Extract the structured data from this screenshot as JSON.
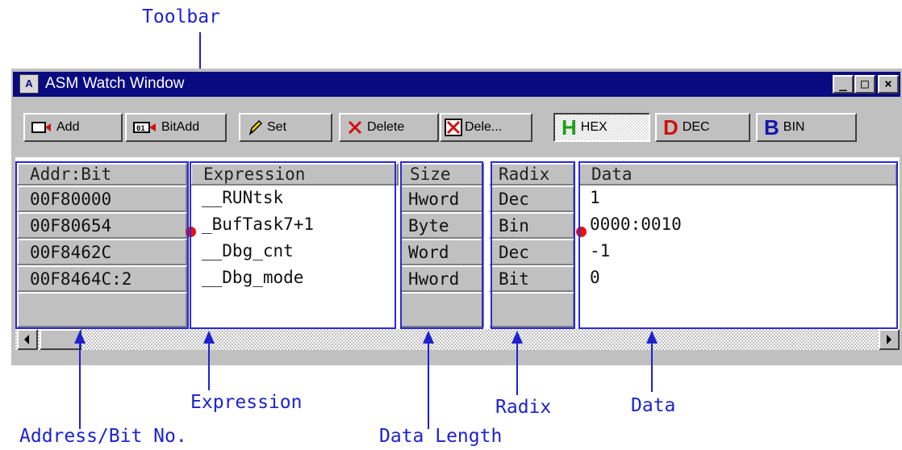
{
  "callouts": {
    "toolbar": "Toolbar",
    "expression": "Expression",
    "address": "Address/Bit No.",
    "data_length": "Data Length",
    "radix": "Radix",
    "data": "Data"
  },
  "window": {
    "title": "ASM Watch Window",
    "minimize": "_",
    "maximize": "□",
    "close": "×"
  },
  "toolbar": {
    "add": "Add",
    "bitadd": "BitAdd",
    "set": "Set",
    "delete": "Delete",
    "delete_all": "Dele...",
    "hex": "HEX",
    "dec": "DEC",
    "bin": "BIN",
    "hex_letter": "H",
    "dec_letter": "D",
    "bin_letter": "B"
  },
  "columns": {
    "addr": "Addr:Bit",
    "expression": "Expression",
    "size": "Size",
    "radix": "Radix",
    "data": "Data"
  },
  "rows": [
    {
      "addr": "00F80000",
      "expr": "__RUNtsk",
      "size": "Hword",
      "radix": "Dec",
      "data": "1"
    },
    {
      "addr": "00F80654",
      "expr": "_BufTask7+1",
      "size": "Byte",
      "radix": "Bin",
      "data": "0000:0010"
    },
    {
      "addr": "00F8462C",
      "expr": "__Dbg_cnt",
      "size": "Word",
      "radix": "Dec",
      "data": "-1"
    },
    {
      "addr": "00F8464C:2",
      "expr": "__Dbg_mode",
      "size": "Hword",
      "radix": "Bit",
      "data": "0"
    }
  ],
  "colors": {
    "annotation": "#1d22d0",
    "titlebar": "#0a0a80",
    "marker": "#e81010"
  },
  "icons": [
    "window-app-icon",
    "add-icon",
    "bitadd-icon",
    "pencil-icon",
    "delete-x-icon",
    "delete-all-icon"
  ]
}
